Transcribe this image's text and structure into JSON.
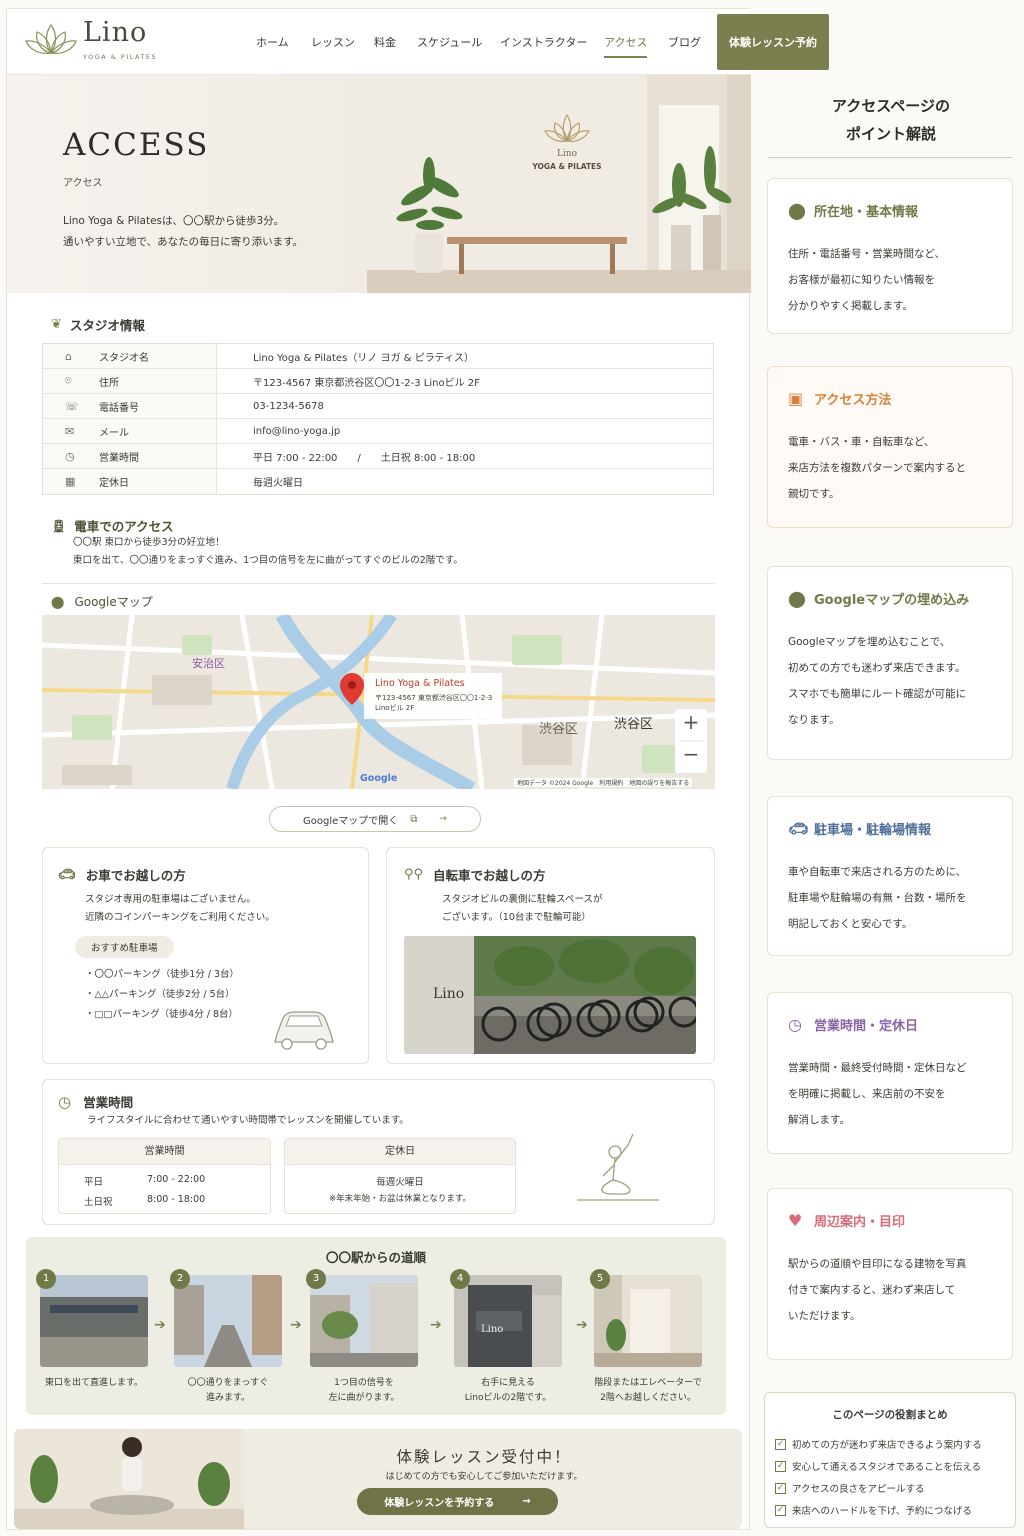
{
  "header": {
    "logo": "Lino",
    "logo_sub": "YOGA & PILATES",
    "nav": [
      "ホーム",
      "レッスン",
      "料金",
      "スケジュール",
      "インストラクター",
      "アクセス",
      "ブログ"
    ],
    "active_nav": "アクセス",
    "cta": "体験レッスン予約"
  },
  "hero": {
    "title": "ACCESS",
    "subtitle": "アクセス",
    "desc_line1": "Lino Yoga & Pilatesは、〇〇駅から徒歩3分。",
    "desc_line2": "通いやすい立地で、あなたの毎日に寄り添います。",
    "wall_logo_line1": "Lino",
    "wall_logo_line2": "YOGA & PILATES"
  },
  "studio": {
    "heading": "スタジオ情報",
    "rows": [
      {
        "icon": "studio-icon",
        "label": "スタジオ名",
        "value": "Lino Yoga & Pilates（リノ ヨガ & ピラティス）"
      },
      {
        "icon": "location-icon",
        "label": "住所",
        "value": "〒123-4567 東京都渋谷区〇〇1-2-3 Linoビル 2F"
      },
      {
        "icon": "phone-icon",
        "label": "電話番号",
        "value": "03-1234-5678"
      },
      {
        "icon": "mail-icon",
        "label": "メール",
        "value": "info@lino-yoga.jp"
      },
      {
        "icon": "clock-icon",
        "label": "営業時間",
        "value": "平日 7:00 - 22:00　　/　　土日祝 8:00 - 18:00"
      },
      {
        "icon": "calendar-icon",
        "label": "定休日",
        "value": "毎週火曜日"
      }
    ]
  },
  "train": {
    "heading": "電車でのアクセス",
    "line1": "〇〇駅 東口から徒歩3分の好立地！",
    "line2": "東口を出て、〇〇通りをまっすぐ進み、1つ目の信号を左に曲がってすぐのビルの2階です。"
  },
  "map": {
    "heading": "Googleマップ",
    "pin_title": "Lino Yoga & Pilates",
    "pin_addr1": "〒123-4567 東京都渋谷区〇〇1-2-3",
    "pin_addr2": "Linoビル 2F",
    "district": "渋谷区",
    "labels": [
      "安治区",
      "渋谷区"
    ],
    "google": "Google",
    "footer": "地図データ ©2024 Google　利用規約　地図の誤りを報告する",
    "zoom_in": "+",
    "zoom_out": "−",
    "open_button": "Googleマップで開く"
  },
  "car": {
    "heading": "お車でお越しの方",
    "line1": "スタジオ専用の駐車場はございません。",
    "line2": "近隣のコインパーキングをご利用ください。",
    "pill": "おすすめ駐車場",
    "items": [
      "・〇〇パーキング（徒歩1分 / 3台）",
      "・△△パーキング（徒歩2分 / 5台）",
      "・□□パーキング（徒歩4分 / 8台）"
    ]
  },
  "bike": {
    "heading": "自転車でお越しの方",
    "line1": "スタジオビルの裏側に駐輪スペースが",
    "line2": "ございます。（10台まで駐輪可能）",
    "sign": "Lino"
  },
  "hours": {
    "heading": "営業時間",
    "desc": "ライフスタイルに合わせて通いやすい時間帯でレッスンを開催しています。",
    "col1": "営業時間",
    "col2": "定休日",
    "weekday_label": "平日",
    "weekday": "7:00 - 22:00",
    "holiday_label": "土日祝",
    "holiday": "8:00 - 18:00",
    "closed": "毎週火曜日",
    "note": "※年末年始・お盆は休業となります。"
  },
  "route": {
    "title": "〇〇駅からの道順",
    "steps": [
      {
        "num": "1",
        "cap1": "東口を出て直進します。",
        "cap2": ""
      },
      {
        "num": "2",
        "cap1": "〇〇通りをまっすぐ",
        "cap2": "進みます。"
      },
      {
        "num": "3",
        "cap1": "1つ目の信号を",
        "cap2": "左に曲がります。"
      },
      {
        "num": "4",
        "cap1": "右手に見える",
        "cap2": "Linoビルの2階です。"
      },
      {
        "num": "5",
        "cap1": "階段またはエレベーターで",
        "cap2": "2階へお越しください。"
      }
    ],
    "sign4": "Lino"
  },
  "banner": {
    "heading": "体験レッスン受付中！",
    "sub": "はじめての方でも安心してご参加いただけます。",
    "button": "体験レッスンを予約する"
  },
  "sidebar": {
    "title_line1": "アクセスページの",
    "title_line2": "ポイント解説",
    "cards": [
      {
        "title": "所在地・基本情報",
        "icon": "location-icon",
        "color": "#6f7a48",
        "lines": [
          "住所・電話番号・営業時間など、",
          "お客様が最初に知りたい情報を",
          "分かりやすく掲載します。"
        ]
      },
      {
        "title": "アクセス方法",
        "icon": "train-icon",
        "color": "#d9803a",
        "lines": [
          "電車・バス・車・自転車など、",
          "来店方法を複数パターンで案内すると",
          "親切です。"
        ]
      },
      {
        "title": "Googleマップの埋め込み",
        "icon": "location-icon",
        "color": "#6f7a48",
        "lines": [
          "Googleマップを埋め込むことで、",
          "初めての方でも迷わず来店できます。",
          "スマホでも簡単にルート確認が可能に",
          "なります。"
        ]
      },
      {
        "title": "駐車場・駐輪場情報",
        "icon": "car-icon",
        "color": "#4f6f9a",
        "lines": [
          "車や自転車で来店される方のために、",
          "駐車場や駐輪場の有無・台数・場所を",
          "明記しておくと安心です。"
        ]
      },
      {
        "title": "営業時間・定休日",
        "icon": "clock-icon",
        "color": "#8a64a8",
        "lines": [
          "営業時間・最終受付時間・定休日など",
          "を明確に掲載し、来店前の不安を",
          "解消します。"
        ]
      },
      {
        "title": "周辺案内・目印",
        "icon": "heart-icon",
        "color": "#d96a7a",
        "lines": [
          "駅からの道順や目印になる建物を写真",
          "付きで案内すると、迷わず来店して",
          "いただけます。"
        ]
      }
    ],
    "summary_title": "このページの役割まとめ",
    "summary": [
      "初めての方が迷わず来店できるよう案内する",
      "安心して通えるスタジオであることを伝える",
      "アクセスの良さをアピールする",
      "来店へのハードルを下げ、予約につなげる"
    ]
  }
}
